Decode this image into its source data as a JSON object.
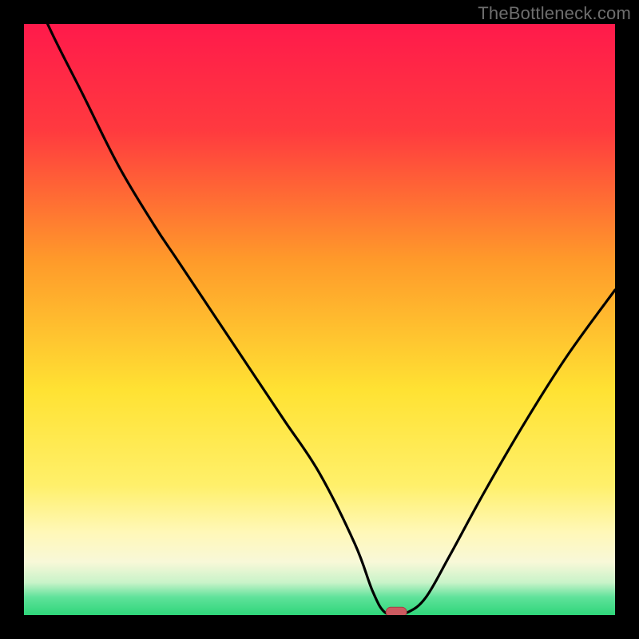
{
  "watermark": "TheBottleneck.com",
  "colors": {
    "frame": "#000000",
    "watermark": "#6e6e6e",
    "curve": "#000000",
    "marker_fill": "#cc5a60",
    "marker_stroke": "#a73e45",
    "grad_top": "#ff1a4b",
    "grad_mid_a": "#ff8a2a",
    "grad_mid_b": "#ffe233",
    "grad_low": "#fff59a",
    "grad_green": "#2fd67a"
  },
  "chart_data": {
    "type": "line",
    "title": "",
    "xlabel": "",
    "ylabel": "",
    "xlim": [
      0,
      100
    ],
    "ylim": [
      0,
      100
    ],
    "x": [
      0,
      4,
      10,
      16,
      22,
      26,
      32,
      38,
      44,
      50,
      56,
      59,
      61,
      63,
      65,
      68,
      72,
      78,
      85,
      92,
      100
    ],
    "values": [
      110,
      100,
      88,
      76,
      66,
      60,
      51,
      42,
      33,
      24,
      12,
      4,
      0.5,
      0.5,
      0.5,
      3,
      10,
      21,
      33,
      44,
      55
    ],
    "marker": {
      "x": 63,
      "y": 0.5
    },
    "background": {
      "type": "vertical-gradient",
      "stops": [
        {
          "pos": 0.0,
          "label": "red"
        },
        {
          "pos": 0.5,
          "label": "yellow"
        },
        {
          "pos": 0.82,
          "label": "pale-yellow"
        },
        {
          "pos": 0.97,
          "label": "green"
        }
      ]
    }
  }
}
